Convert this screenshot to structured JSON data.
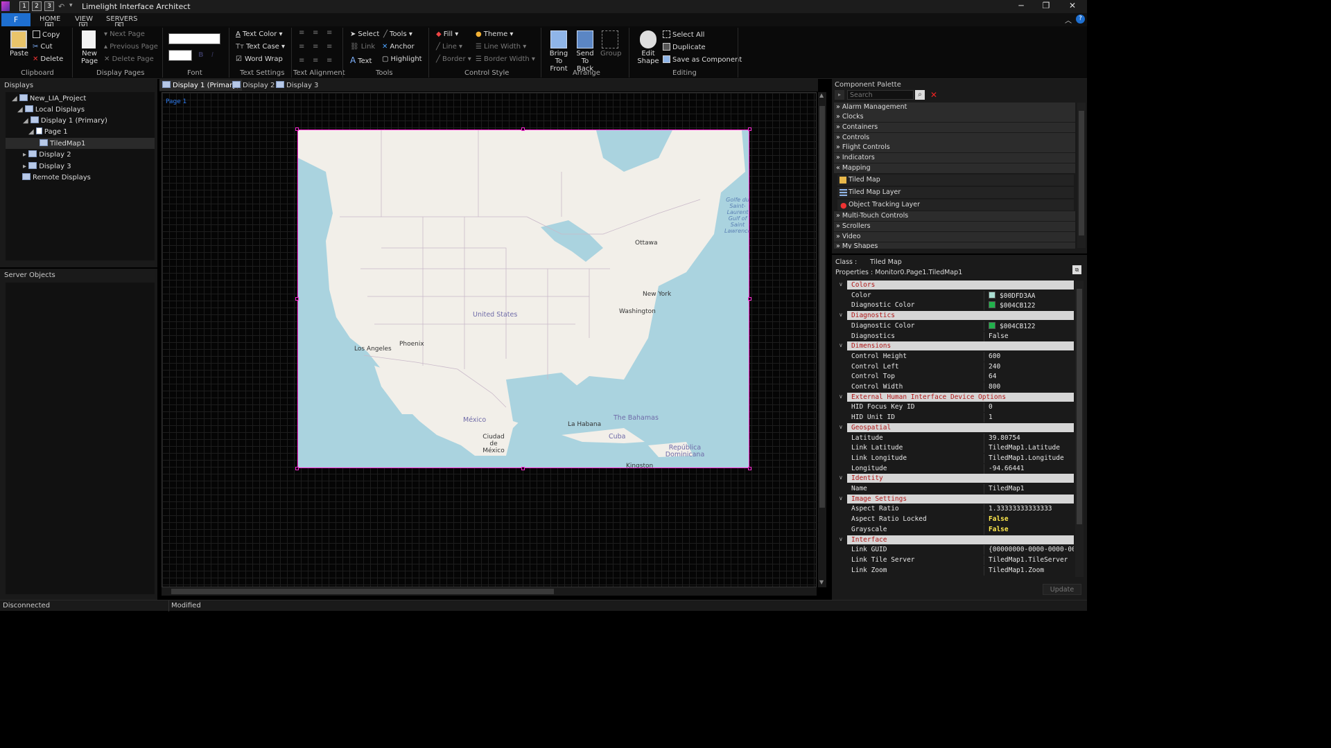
{
  "app": {
    "title": "Limelight Interface Architect"
  },
  "quick_access": [
    "1",
    "2",
    "3"
  ],
  "menu_tabs": {
    "file": "F",
    "home": "HOME",
    "view": "VIEW",
    "servers": "SERVERS",
    "keytip_home": "H",
    "keytip_view": "V",
    "keytip_servers": "S"
  },
  "ribbon": {
    "clipboard": {
      "paste": "Paste",
      "copy": "Copy",
      "cut": "Cut",
      "delete": "Delete",
      "label": "Clipboard"
    },
    "display_pages": {
      "new_page": "New Page",
      "next_page": "Next Page",
      "previous_page": "Previous Page",
      "delete_page": "Delete Page",
      "label": "Display Pages"
    },
    "font": {
      "bold": "B",
      "italic": "I",
      "label": "Font"
    },
    "text_settings": {
      "text_color": "Text Color",
      "text_case": "Text Case",
      "word_wrap": "Word Wrap",
      "label": "Text Settings"
    },
    "text_alignment": {
      "label": "Text Alignment"
    },
    "tools": {
      "select": "Select",
      "tools": "Tools",
      "link": "Link",
      "anchor": "Anchor",
      "text": "Text",
      "highlight": "Highlight",
      "label": "Tools"
    },
    "control_style": {
      "fill": "Fill",
      "theme": "Theme",
      "line": "Line",
      "line_width": "Line Width",
      "border": "Border",
      "border_width": "Border Width",
      "label": "Control Style"
    },
    "arrange": {
      "bring_to_front": "Bring To Front",
      "send_to_back": "Send To Back",
      "group": "Group",
      "label": "Arrange"
    },
    "editing": {
      "edit_shape": "Edit Shape",
      "select_all": "Select All",
      "duplicate": "Duplicate",
      "save_as_component": "Save as Component",
      "label": "Editing"
    }
  },
  "displays_panel": {
    "title": "Displays",
    "tree": [
      {
        "label": "New_LIA_Project"
      },
      {
        "label": "Local Displays"
      },
      {
        "label": "Display 1 (Primary)"
      },
      {
        "label": "Page 1"
      },
      {
        "label": "TiledMap1"
      },
      {
        "label": "Display 2"
      },
      {
        "label": "Display 3"
      },
      {
        "label": "Remote Displays"
      }
    ]
  },
  "server_objects": {
    "title": "Server Objects"
  },
  "doc_tabs": [
    {
      "label": "Display 1 (Primary)"
    },
    {
      "label": "Display 2"
    },
    {
      "label": "Display 3"
    }
  ],
  "canvas": {
    "page_label": "Page 1"
  },
  "map": {
    "cities": [
      "Ottawa",
      "New York",
      "Washington",
      "Los Angeles",
      "Phoenix",
      "Ciudad de México",
      "La Habana",
      "Kingston"
    ],
    "countries": [
      "United States",
      "México",
      "Cuba",
      "The Bahamas",
      "República Dominicana"
    ],
    "water": [
      "Golfe du Saint-Laurent Gulf of Saint Lawrence"
    ]
  },
  "palette": {
    "title": "Component Palette",
    "search_placeholder": "Search",
    "categories": [
      {
        "label": "Alarm Management"
      },
      {
        "label": "Clocks"
      },
      {
        "label": "Containers"
      },
      {
        "label": "Controls"
      },
      {
        "label": "Flight Controls"
      },
      {
        "label": "Indicators"
      },
      {
        "label": "Mapping"
      }
    ],
    "mapping_items": [
      {
        "label": "Tiled Map"
      },
      {
        "label": "Tiled Map Layer"
      },
      {
        "label": "Object Tracking Layer"
      }
    ],
    "categories_after": [
      {
        "label": "Multi-Touch Controls"
      },
      {
        "label": "Scrollers"
      },
      {
        "label": "Video"
      },
      {
        "label": "My Shapes"
      }
    ]
  },
  "properties": {
    "class_label": "Class :",
    "class_value": "Tiled Map",
    "path": "Properties : Monitor0.Page1.TiledMap1",
    "categories": [
      {
        "name": "Colors",
        "rows": [
          {
            "name": "Color",
            "value": "$00DFD3AA",
            "swatch": "#aadfd3"
          },
          {
            "name": "Diagnostic Color",
            "value": "$004CB122",
            "swatch": "#22b14c"
          }
        ]
      },
      {
        "name": "Diagnostics",
        "rows": [
          {
            "name": "Diagnostic Color",
            "value": "$004CB122",
            "swatch": "#22b14c"
          },
          {
            "name": "Diagnostics",
            "value": "False"
          }
        ]
      },
      {
        "name": "Dimensions",
        "rows": [
          {
            "name": "Control Height",
            "value": "600"
          },
          {
            "name": "Control Left",
            "value": "240"
          },
          {
            "name": "Control Top",
            "value": "64"
          },
          {
            "name": "Control Width",
            "value": "800"
          }
        ]
      },
      {
        "name": "External Human Interface Device Options",
        "rows": [
          {
            "name": "HID Focus Key ID",
            "value": "0"
          },
          {
            "name": "HID Unit ID",
            "value": "1"
          }
        ]
      },
      {
        "name": "Geospatial",
        "rows": [
          {
            "name": "Latitude",
            "value": "39.80754"
          },
          {
            "name": "Link Latitude",
            "value": "TiledMap1.Latitude"
          },
          {
            "name": "Link Longitude",
            "value": "TiledMap1.Longitude"
          },
          {
            "name": "Longitude",
            "value": "-94.66441"
          }
        ]
      },
      {
        "name": "Identity",
        "rows": [
          {
            "name": "Name",
            "value": "TiledMap1"
          }
        ]
      },
      {
        "name": "Image Settings",
        "rows": [
          {
            "name": "Aspect Ratio",
            "value": "1.33333333333333"
          },
          {
            "name": "Aspect Ratio Locked",
            "value": "False",
            "highlight": true
          },
          {
            "name": "Grayscale",
            "value": "False",
            "highlight": true
          }
        ]
      },
      {
        "name": "Interface",
        "rows": [
          {
            "name": "Link GUID",
            "value": "{00000000-0000-0000-00"
          },
          {
            "name": "Link Tile Server",
            "value": "TiledMap1.TileServer"
          },
          {
            "name": "Link Zoom",
            "value": "TiledMap1.Zoom"
          }
        ]
      }
    ],
    "update_button": "Update"
  },
  "status": {
    "left": "Disconnected",
    "middle": "Modified"
  }
}
